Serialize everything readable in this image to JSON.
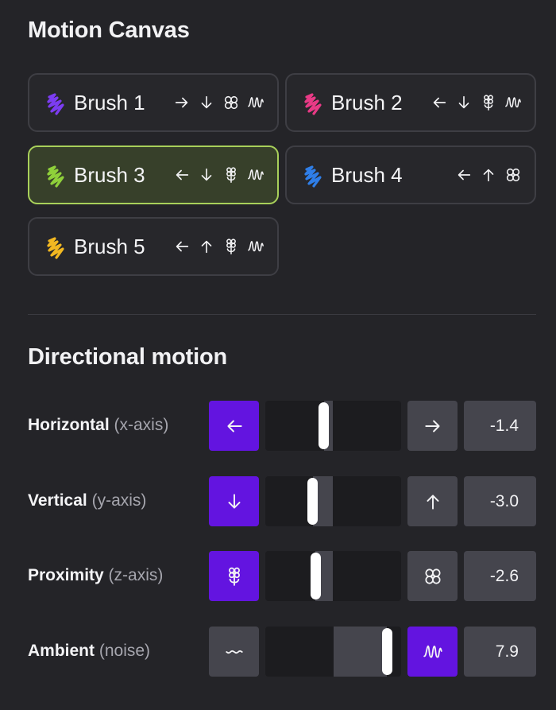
{
  "canvas": {
    "title": "Motion Canvas",
    "brushes": [
      {
        "name": "Brush 1",
        "color": "#7c3cf2",
        "selected": false,
        "glyphs": [
          "arrow-right-icon",
          "arrow-down-icon",
          "clover-icon",
          "wave-icon"
        ]
      },
      {
        "name": "Brush 2",
        "color": "#e83a86",
        "selected": false,
        "glyphs": [
          "arrow-left-icon",
          "arrow-down-icon",
          "flower-icon",
          "wave-icon"
        ]
      },
      {
        "name": "Brush 3",
        "color": "#8fd03a",
        "selected": true,
        "glyphs": [
          "arrow-left-icon",
          "arrow-down-icon",
          "flower-icon",
          "wave-icon"
        ]
      },
      {
        "name": "Brush 4",
        "color": "#2f7ee8",
        "selected": false,
        "glyphs": [
          "arrow-left-icon",
          "arrow-up-icon",
          "clover-icon"
        ]
      },
      {
        "name": "Brush 5",
        "color": "#f2b821",
        "selected": false,
        "glyphs": [
          "arrow-left-icon",
          "arrow-up-icon",
          "flower-icon",
          "wave-icon"
        ]
      }
    ]
  },
  "motion": {
    "title": "Directional motion",
    "rows": [
      {
        "label": "Horizontal",
        "sub": "(x-axis)",
        "value": "-1.4",
        "level": -1.4,
        "neg_icon": "arrow-left-icon",
        "pos_icon": "arrow-right-icon",
        "active": "neg"
      },
      {
        "label": "Vertical",
        "sub": "(y-axis)",
        "value": "-3.0",
        "level": -3.0,
        "neg_icon": "arrow-down-icon",
        "pos_icon": "arrow-up-icon",
        "active": "neg"
      },
      {
        "label": "Proximity",
        "sub": "(z-axis)",
        "value": "-2.6",
        "level": -2.6,
        "neg_icon": "flower-icon",
        "pos_icon": "clover-icon",
        "active": "neg"
      },
      {
        "label": "Ambient",
        "sub": "(noise)",
        "value": "7.9",
        "level": 7.9,
        "neg_icon": "calm-wave-icon",
        "pos_icon": "wave-icon",
        "active": "pos"
      }
    ]
  },
  "colors": {
    "accent": "#6314e0",
    "selected_border": "#a8d05a",
    "selected_bg": "#37402a"
  }
}
